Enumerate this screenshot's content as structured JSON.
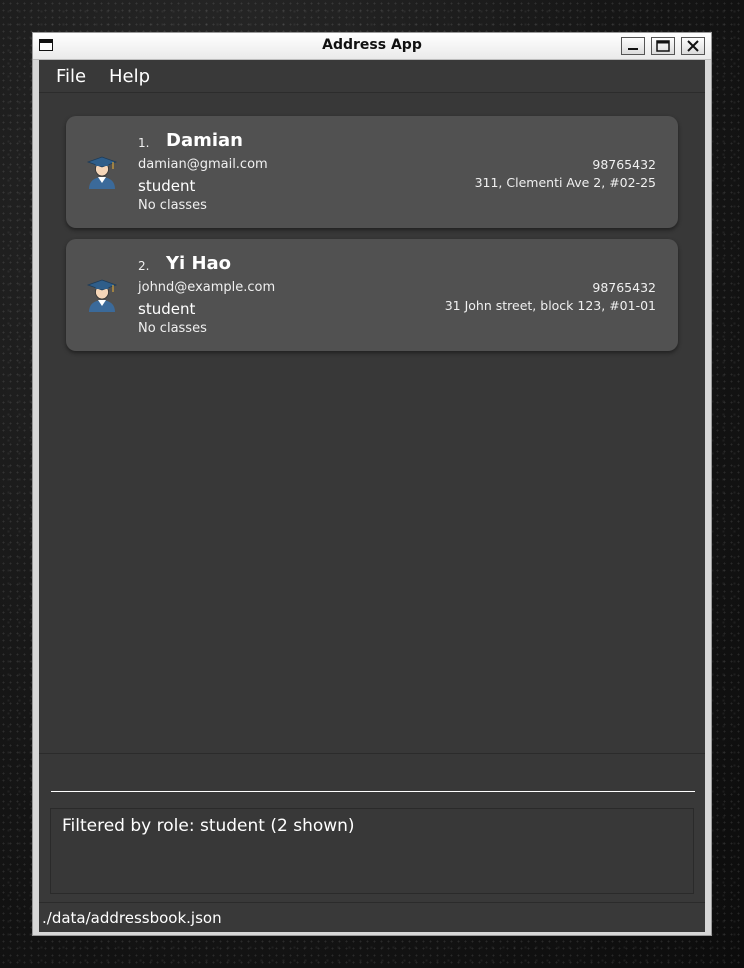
{
  "window": {
    "title": "Address App"
  },
  "menu": {
    "items": [
      {
        "label": "File"
      },
      {
        "label": "Help"
      }
    ]
  },
  "persons": [
    {
      "index": "1.",
      "name": "Damian",
      "email": "damian@gmail.com",
      "role": "student",
      "classes": "No classes",
      "phone": "98765432",
      "address": "311, Clementi Ave 2, #02-25",
      "icon": "student-graduate-icon"
    },
    {
      "index": "2.",
      "name": "Yi Hao",
      "email": "johnd@example.com",
      "role": "student",
      "classes": "No classes",
      "phone": "98765432",
      "address": "31 John street, block 123, #01-01",
      "icon": "student-graduate-icon"
    }
  ],
  "command": {
    "value": ""
  },
  "result": {
    "text": "Filtered by role: student (2 shown)"
  },
  "status": {
    "path": "./data/addressbook.json"
  },
  "colors": {
    "background": "#393939",
    "card": "#515151",
    "text": "#ffffff",
    "accent": "#3b6a9a"
  }
}
